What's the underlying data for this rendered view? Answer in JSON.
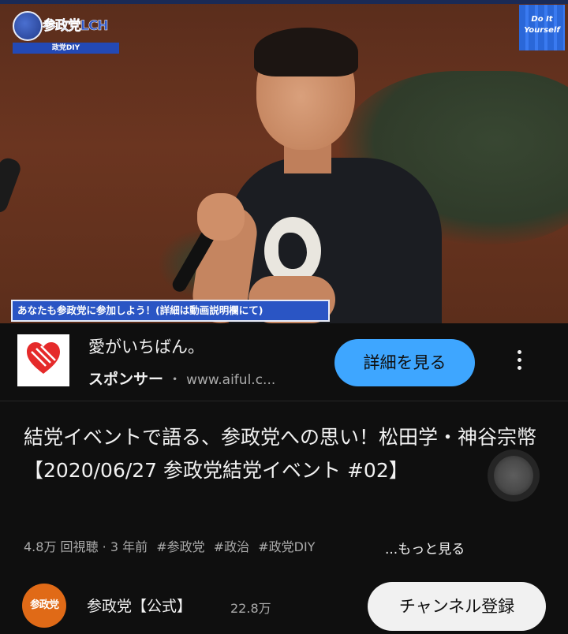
{
  "player": {
    "brand_name": "参政党LCH",
    "brand_sub": "政党DIY",
    "badge_line1": "Do It",
    "badge_line2": "Yourself",
    "caption": "あなたも参政党に参加しよう！(詳細は動画説明欄にて)"
  },
  "ad": {
    "title": "愛がいちばん。",
    "sponsor_label": "スポンサー",
    "separator": "・",
    "url": "www.aiful.c...",
    "cta_label": "詳細を見る",
    "more_icon": "more-vert-icon",
    "logo_color": "#e52a2a"
  },
  "video": {
    "title": "結党イベントで語る、参政党への思い！松田学・神谷宗幣【2020/06/27 参政党結党イベント #02】",
    "views": "4.8万 回視聴",
    "dot": "·",
    "age": "3 年前",
    "tags": [
      "#参政党",
      "#政治",
      "#政党DIY"
    ],
    "show_more": "...もっと見る"
  },
  "channel": {
    "avatar_text": "参政党",
    "name": "参政党【公式】",
    "subscribers": "22.8万",
    "subscribe_label": "チャンネル登録"
  },
  "colors": {
    "background": "#0f0f0f",
    "accent_blue": "#3ea6ff",
    "channel_orange": "#e06a17"
  }
}
